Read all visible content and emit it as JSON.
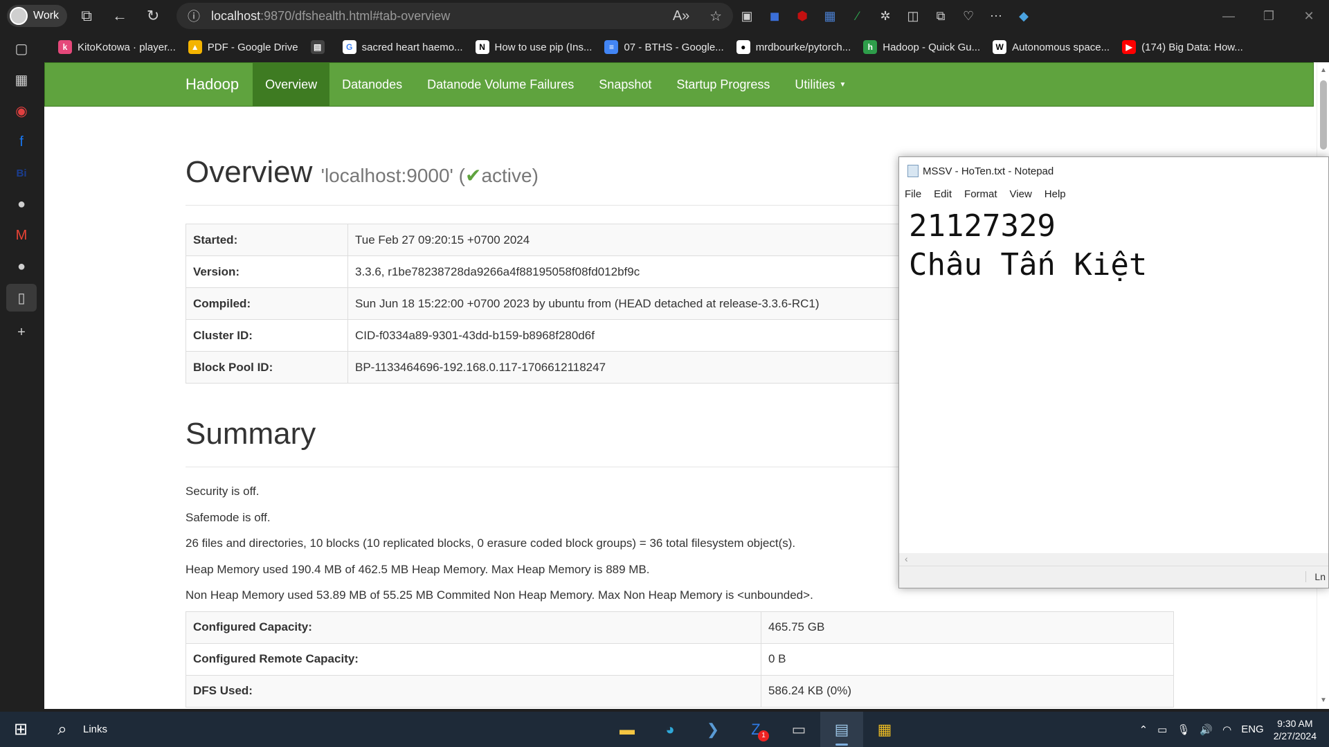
{
  "browser": {
    "profile": "Work",
    "url_host": "localhost",
    "url_rest": ":9870/dfshealth.html#tab-overview",
    "bookmarks": [
      {
        "label": "KitoKotowa · player...",
        "icon_color": "#e5487a"
      },
      {
        "label": "PDF - Google Drive",
        "icon_color": "#f4b400"
      },
      {
        "label": "",
        "icon_color": "#666666"
      },
      {
        "label": "sacred heart haemo...",
        "icon_color": "#4285f4"
      },
      {
        "label": "How to use pip (Ins...",
        "icon_color": "#ffffff"
      },
      {
        "label": "07 - BTHS - Google...",
        "icon_color": "#4285f4"
      },
      {
        "label": "mrdbourke/pytorch...",
        "icon_color": "#ffffff"
      },
      {
        "label": "Hadoop - Quick Gu...",
        "icon_color": "#2e9d4a"
      },
      {
        "label": "Autonomous space...",
        "icon_color": "#ffffff"
      },
      {
        "label": "(174) Big Data: How...",
        "icon_color": "#ff0000"
      }
    ]
  },
  "hadoop": {
    "brand": "Hadoop",
    "nav": [
      "Overview",
      "Datanodes",
      "Datanode Volume Failures",
      "Snapshot",
      "Startup Progress",
      "Utilities"
    ],
    "overview_title": "Overview",
    "overview_sub": "'localhost:9000' (",
    "overview_state": "active",
    "overview_close": ")",
    "info": [
      {
        "k": "Started:",
        "v": "Tue Feb 27 09:20:15 +0700 2024"
      },
      {
        "k": "Version:",
        "v": "3.3.6, r1be78238728da9266a4f88195058f08fd012bf9c"
      },
      {
        "k": "Compiled:",
        "v": "Sun Jun 18 15:22:00 +0700 2023 by ubuntu from (HEAD detached at release-3.3.6-RC1)"
      },
      {
        "k": "Cluster ID:",
        "v": "CID-f0334a89-9301-43dd-b159-b8968f280d6f"
      },
      {
        "k": "Block Pool ID:",
        "v": "BP-1133464696-192.168.0.117-1706612118247"
      }
    ],
    "summary_title": "Summary",
    "summary_lines": [
      "Security is off.",
      "Safemode is off.",
      "26 files and directories, 10 blocks (10 replicated blocks, 0 erasure coded block groups) = 36 total filesystem object(s).",
      "Heap Memory used 190.4 MB of 462.5 MB Heap Memory. Max Heap Memory is 889 MB.",
      "Non Heap Memory used 53.89 MB of 55.25 MB Commited Non Heap Memory. Max Non Heap Memory is <unbounded>."
    ],
    "capacity": [
      {
        "k": "Configured Capacity:",
        "v": "465.75 GB"
      },
      {
        "k": "Configured Remote Capacity:",
        "v": "0 B"
      },
      {
        "k": "DFS Used:",
        "v": "586.24 KB (0%)"
      }
    ]
  },
  "notepad": {
    "title": "MSSV - HoTen.txt - Notepad",
    "menu": [
      "File",
      "Edit",
      "Format",
      "View",
      "Help"
    ],
    "line1": "21127329",
    "line2": "Châu Tấn Kiệt",
    "status": "Ln"
  },
  "taskbar": {
    "links": "Links",
    "lang": "ENG",
    "time": "9:30 AM",
    "date": "2/27/2024",
    "badge": "1"
  }
}
